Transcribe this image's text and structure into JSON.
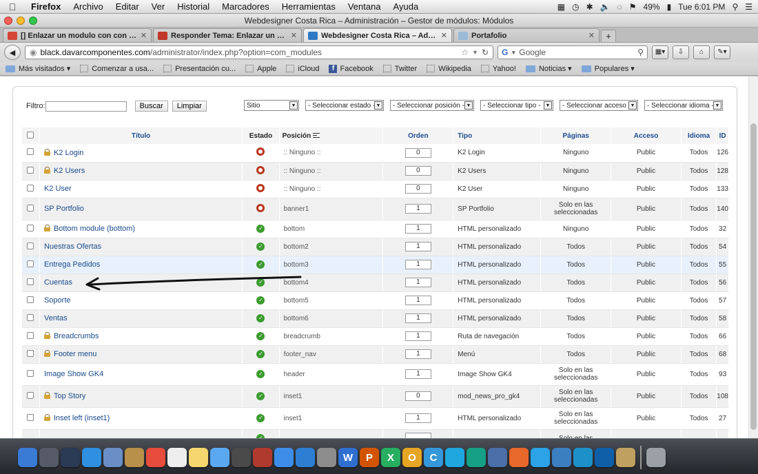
{
  "menubar": {
    "items": [
      "Firefox",
      "Archivo",
      "Editar",
      "Ver",
      "Historial",
      "Marcadores",
      "Herramientas",
      "Ventana",
      "Ayuda"
    ],
    "battery": "49%",
    "clock": "Tue 6:01 PM"
  },
  "window": {
    "title": "Webdesigner Costa Rica – Administración – Gestor de módulos: Módulos"
  },
  "tabs": [
    {
      "label": "[] Enlazar un modulo con con u...",
      "favicon": "gmail-icon",
      "color": "#d44638",
      "active": false
    },
    {
      "label": "Responder Tema: Enlazar un m...",
      "favicon": "forum-icon",
      "color": "#c0392b",
      "active": false
    },
    {
      "label": "Webdesigner Costa Rica – Admi...",
      "favicon": "joomla-icon",
      "color": "#2f78c4",
      "active": true
    },
    {
      "label": "Portafolio",
      "favicon": "page-icon",
      "color": "#9abad8",
      "active": false
    }
  ],
  "nav": {
    "url_host": "black.davarcomponentes.com",
    "url_path": "/administrator/index.php?option=com_modules",
    "search_placeholder": "Google"
  },
  "bookmarks": [
    {
      "label": "Más visitados ▾",
      "kind": "folder"
    },
    {
      "label": "Comenzar a usa...",
      "kind": "page"
    },
    {
      "label": "Presentación cu...",
      "kind": "page"
    },
    {
      "label": "Apple",
      "kind": "page"
    },
    {
      "label": "iCloud",
      "kind": "page"
    },
    {
      "label": "Facebook",
      "kind": "facebook"
    },
    {
      "label": "Twitter",
      "kind": "page"
    },
    {
      "label": "Wikipedia",
      "kind": "page"
    },
    {
      "label": "Yahoo!",
      "kind": "page"
    },
    {
      "label": "Noticias ▾",
      "kind": "folder"
    },
    {
      "label": "Populares ▾",
      "kind": "folder"
    }
  ],
  "filters": {
    "label": "Filtro:",
    "search_button": "Buscar",
    "clear_button": "Limpiar",
    "selects": [
      "Sitio",
      "- Seleccionar estado -",
      "- Seleccionar posición -",
      "- Seleccionar tipo -",
      "- Seleccionar acceso -",
      "- Seleccionar idioma -"
    ]
  },
  "table": {
    "headers": [
      "Título",
      "Estado",
      "Posición",
      "Orden",
      "Tipo",
      "Páginas",
      "Acceso",
      "Idioma",
      "ID"
    ],
    "rows": [
      {
        "title": "K2 Login",
        "locked": true,
        "published": false,
        "position": ":: Ninguno ::",
        "order": "0",
        "type": "K2 Login",
        "pages": "Ninguno",
        "access": "Public",
        "language": "Todos",
        "id": "126"
      },
      {
        "title": "K2 Users",
        "locked": true,
        "published": false,
        "position": ":: Ninguno ::",
        "order": "0",
        "type": "K2 Users",
        "pages": "Ninguno",
        "access": "Public",
        "language": "Todos",
        "id": "128"
      },
      {
        "title": "K2 User",
        "locked": false,
        "published": false,
        "position": ":: Ninguno ::",
        "order": "0",
        "type": "K2 User",
        "pages": "Ninguno",
        "access": "Public",
        "language": "Todos",
        "id": "133"
      },
      {
        "title": "SP Portfolio",
        "locked": false,
        "published": false,
        "position": "banner1",
        "order": "1",
        "type": "SP Portfolio",
        "pages": "Solo en las seleccionadas",
        "access": "Public",
        "language": "Todos",
        "id": "140"
      },
      {
        "title": "Bottom module (bottom)",
        "locked": true,
        "published": true,
        "position": "bottom",
        "order": "1",
        "type": "HTML personalizado",
        "pages": "Ninguno",
        "access": "Public",
        "language": "Todos",
        "id": "32"
      },
      {
        "title": "Nuestras Ofertas",
        "locked": false,
        "published": true,
        "position": "bottom2",
        "order": "1",
        "type": "HTML personalizado",
        "pages": "Todos",
        "access": "Public",
        "language": "Todos",
        "id": "54"
      },
      {
        "title": "Entrega Pedidos",
        "locked": false,
        "published": true,
        "position": "bottom3",
        "order": "1",
        "type": "HTML personalizado",
        "pages": "Todos",
        "access": "Public",
        "language": "Todos",
        "id": "55"
      },
      {
        "title": "Cuentas",
        "locked": false,
        "published": true,
        "position": "bottom4",
        "order": "1",
        "type": "HTML personalizado",
        "pages": "Todos",
        "access": "Public",
        "language": "Todos",
        "id": "56"
      },
      {
        "title": "Soporte",
        "locked": false,
        "published": true,
        "position": "bottom5",
        "order": "1",
        "type": "HTML personalizado",
        "pages": "Todos",
        "access": "Public",
        "language": "Todos",
        "id": "57"
      },
      {
        "title": "Ventas",
        "locked": false,
        "published": true,
        "position": "bottom6",
        "order": "1",
        "type": "HTML personalizado",
        "pages": "Todos",
        "access": "Public",
        "language": "Todos",
        "id": "58"
      },
      {
        "title": "Breadcrumbs",
        "locked": true,
        "published": true,
        "position": "breadcrumb",
        "order": "1",
        "type": "Ruta de navegación",
        "pages": "Todos",
        "access": "Public",
        "language": "Todos",
        "id": "66"
      },
      {
        "title": "Footer menu",
        "locked": true,
        "published": true,
        "position": "footer_nav",
        "order": "1",
        "type": "Menú",
        "pages": "Todos",
        "access": "Public",
        "language": "Todos",
        "id": "68"
      },
      {
        "title": "Image Show GK4",
        "locked": false,
        "published": true,
        "position": "header",
        "order": "1",
        "type": "Image Show GK4",
        "pages": "Solo en las seleccionadas",
        "access": "Public",
        "language": "Todos",
        "id": "93"
      },
      {
        "title": "Top Story",
        "locked": true,
        "published": true,
        "position": "inset1",
        "order": "0",
        "type": "mod_news_pro_gk4",
        "pages": "Solo en las seleccionadas",
        "access": "Public",
        "language": "Todos",
        "id": "108"
      },
      {
        "title": "Inset left (inset1)",
        "locked": true,
        "published": true,
        "position": "inset1",
        "order": "1",
        "type": "HTML personalizado",
        "pages": "Solo en las seleccionadas",
        "access": "Public",
        "language": "Todos",
        "id": "27"
      }
    ],
    "partial_row_pages": "Solo en las"
  },
  "dock": {
    "apps": [
      {
        "name": "finder-icon",
        "color": "#3a7bd5"
      },
      {
        "name": "launchpad-icon",
        "color": "#555a66"
      },
      {
        "name": "mission-control-icon",
        "color": "#2b3a55"
      },
      {
        "name": "safari-icon",
        "color": "#2f8fe0"
      },
      {
        "name": "mail-icon",
        "color": "#6a8fc7"
      },
      {
        "name": "contacts-icon",
        "color": "#b8904a"
      },
      {
        "name": "calendar-icon",
        "color": "#e74c3c"
      },
      {
        "name": "reminders-icon",
        "color": "#eeeeee"
      },
      {
        "name": "notes-icon",
        "color": "#f5d76e"
      },
      {
        "name": "messages-icon",
        "color": "#5aa9f0"
      },
      {
        "name": "facetime-icon",
        "color": "#4a4a4a"
      },
      {
        "name": "photo-booth-icon",
        "color": "#b03a2e"
      },
      {
        "name": "itunes-icon",
        "color": "#3d8ee8"
      },
      {
        "name": "app-store-icon",
        "color": "#2d7fd3"
      },
      {
        "name": "system-preferences-icon",
        "color": "#8c8c8c"
      },
      {
        "name": "word-icon",
        "color": "#2f6fd0",
        "letter": "W"
      },
      {
        "name": "powerpoint-icon",
        "color": "#d35400",
        "letter": "P"
      },
      {
        "name": "excel-icon",
        "color": "#27ae60",
        "letter": "X"
      },
      {
        "name": "outlook-icon",
        "color": "#e6a623",
        "letter": "O"
      },
      {
        "name": "communicator-icon",
        "color": "#3498db",
        "letter": "C"
      },
      {
        "name": "messenger-icon",
        "color": "#1fa8e0"
      },
      {
        "name": "remote-desktop-icon",
        "color": "#16a085"
      },
      {
        "name": "xcode-icon",
        "color": "#4b6fa8"
      },
      {
        "name": "firefox-icon",
        "color": "#e8682a"
      },
      {
        "name": "twitter-icon",
        "color": "#2ba3e6"
      },
      {
        "name": "pencil-icon",
        "color": "#3c7fc0"
      },
      {
        "name": "adium-icon",
        "color": "#1e90c8"
      },
      {
        "name": "teamviewer-icon",
        "color": "#0e5fa8"
      },
      {
        "name": "preview-icon",
        "color": "#c0a060"
      },
      {
        "name": "trash-icon",
        "color": "#9aa0a6"
      }
    ]
  }
}
